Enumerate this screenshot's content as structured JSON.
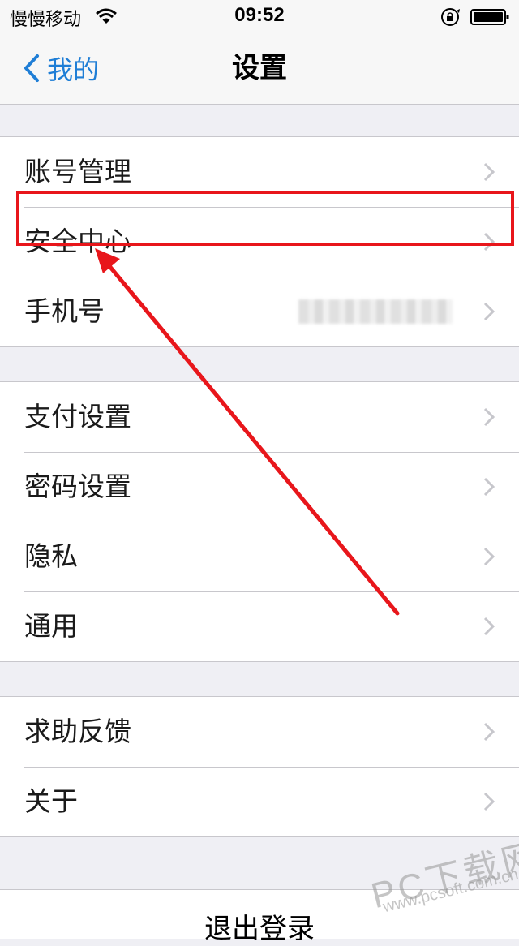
{
  "status_bar": {
    "carrier": "慢慢移动",
    "time": "09:52"
  },
  "nav": {
    "back_label": "我的",
    "title": "设置"
  },
  "groups": [
    {
      "rows": [
        {
          "label": "账号管理"
        },
        {
          "label": "安全中心"
        },
        {
          "label": "手机号"
        }
      ]
    },
    {
      "rows": [
        {
          "label": "支付设置"
        },
        {
          "label": "密码设置"
        },
        {
          "label": "隐私"
        },
        {
          "label": "通用"
        }
      ]
    },
    {
      "rows": [
        {
          "label": "求助反馈"
        },
        {
          "label": "关于"
        }
      ]
    }
  ],
  "logout_label": "退出登录",
  "watermark": {
    "main": "PC下载网",
    "url": "www.pcsoft.com.cn"
  },
  "colors": {
    "accent": "#1f7ed6",
    "highlight": "#e8161b",
    "background": "#efeff4"
  },
  "icons": {
    "back": "chevron-left-icon",
    "row": "chevron-right-icon",
    "wifi": "wifi-icon",
    "lock": "rotation-lock-icon",
    "battery": "battery-icon"
  }
}
